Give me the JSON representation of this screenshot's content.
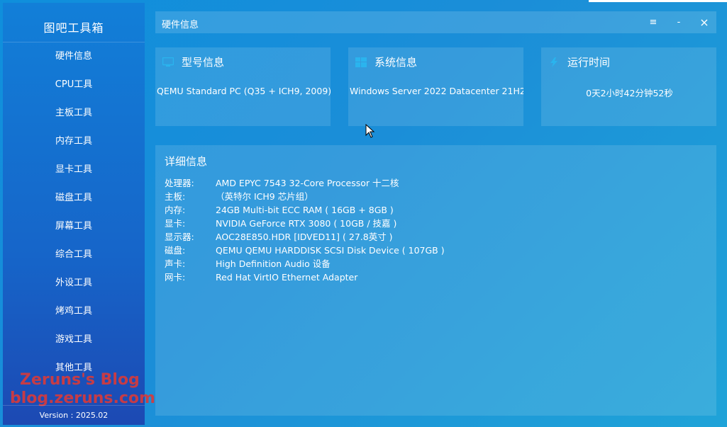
{
  "app": {
    "title": "图吧工具箱",
    "version": "Version : 2025.02"
  },
  "sidebar": {
    "items": [
      {
        "label": "硬件信息"
      },
      {
        "label": "CPU工具"
      },
      {
        "label": "主板工具"
      },
      {
        "label": "内存工具"
      },
      {
        "label": "显卡工具"
      },
      {
        "label": "磁盘工具"
      },
      {
        "label": "屏幕工具"
      },
      {
        "label": "综合工具"
      },
      {
        "label": "外设工具"
      },
      {
        "label": "烤鸡工具"
      },
      {
        "label": "游戏工具"
      },
      {
        "label": "其他工具"
      }
    ]
  },
  "watermark": {
    "line1": "Zeruns's Blog",
    "line2": "blog.zeruns.com"
  },
  "titlebar": {
    "title": "硬件信息",
    "menu_icon": "≡",
    "minimize_icon": "-",
    "close_icon": "×"
  },
  "cards": {
    "model": {
      "title": "型号信息",
      "value": "QEMU Standard PC (Q35 + ICH9, 2009)",
      "icon": "monitor-icon"
    },
    "system": {
      "title": "系统信息",
      "value": "Windows Server 2022 Datacenter 21H2",
      "icon": "windows-icon"
    },
    "uptime": {
      "title": "运行时间",
      "value": "0天2小时42分钟52秒",
      "icon": "lightning-icon"
    }
  },
  "details": {
    "title": "详细信息",
    "rows": [
      {
        "label": "处理器:",
        "value": "AMD EPYC 7543 32-Core Processor 十二核"
      },
      {
        "label": "主板:",
        "value": "（英特尔 ICH9 芯片组）"
      },
      {
        "label": "内存:",
        "value": "24GB Multi-bit ECC RAM ( 16GB + 8GB )"
      },
      {
        "label": "显卡:",
        "value": "NVIDIA GeForce RTX 3080 ( 10GB / 技嘉 )"
      },
      {
        "label": "显示器:",
        "value": "AOC28E850.HDR [IDVED11] ( 27.8英寸 )"
      },
      {
        "label": "磁盘:",
        "value": "QEMU QEMU HARDDISK SCSI Disk Device ( 107GB )"
      },
      {
        "label": "声卡:",
        "value": "High Definition Audio 设备"
      },
      {
        "label": "网卡:",
        "value": "Red Hat VirtIO Ethernet Adapter"
      }
    ]
  },
  "colors": {
    "background": "#1b8ed8",
    "sidebar_top": "#127fd8",
    "sidebar_bottom": "#1c49b3",
    "watermark": "#d93a3a"
  }
}
